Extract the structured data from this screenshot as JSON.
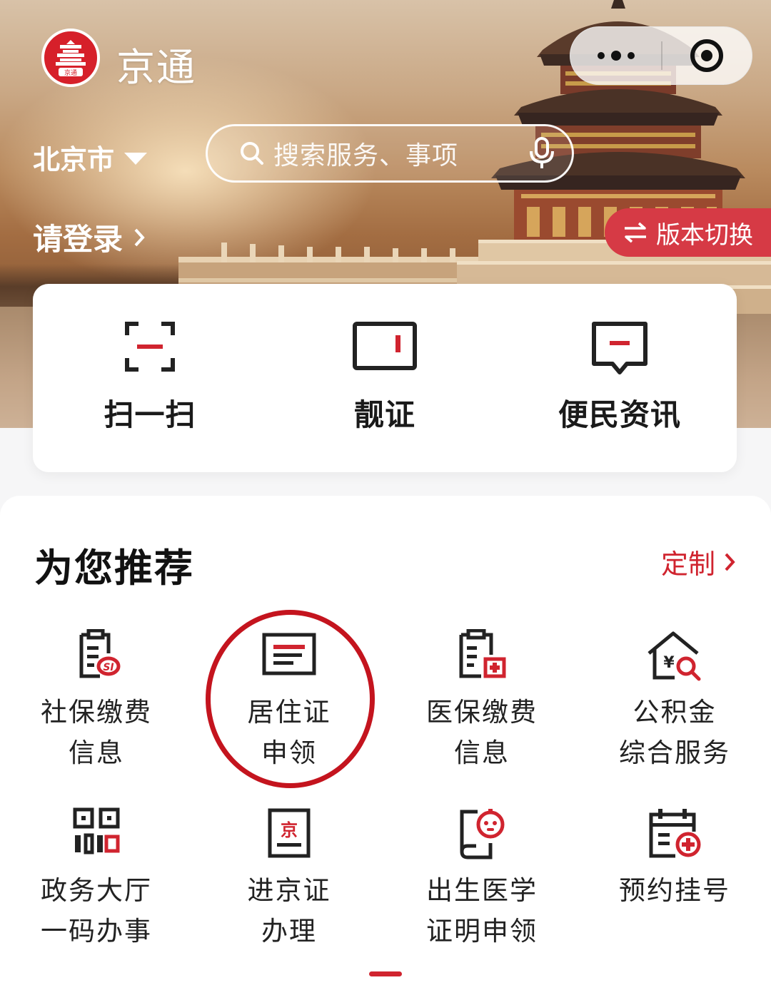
{
  "header": {
    "app_title": "京通",
    "logo_text": "京通",
    "capsule": {
      "more_icon": "more-dots-icon",
      "close_icon": "target-close-icon"
    },
    "city": "北京市",
    "search_placeholder": "搜索服务、事项",
    "login_text": "请登录",
    "switch_label": "版本切换"
  },
  "quick_actions": [
    {
      "label": "扫一扫",
      "icon": "scan-icon"
    },
    {
      "label": "靓证",
      "icon": "card-icon"
    },
    {
      "label": "便民资讯",
      "icon": "message-icon"
    }
  ],
  "recommend": {
    "title": "为您推荐",
    "custom_label": "定制",
    "items": [
      {
        "line1": "社保缴费",
        "line2": "信息",
        "icon": "social-security-icon"
      },
      {
        "line1": "居住证",
        "line2": "申领",
        "icon": "residence-permit-icon",
        "highlighted": true
      },
      {
        "line1": "医保缴费",
        "line2": "信息",
        "icon": "medical-insurance-icon"
      },
      {
        "line1": "公积金",
        "line2": "综合服务",
        "icon": "housing-fund-icon"
      },
      {
        "line1": "政务大厅",
        "line2": "一码办事",
        "icon": "qr-code-icon"
      },
      {
        "line1": "进京证",
        "line2": "办理",
        "icon": "beijing-entry-permit-icon"
      },
      {
        "line1": "出生医学",
        "line2": "证明申领",
        "icon": "birth-certificate-icon"
      },
      {
        "line1": "预约挂号",
        "line2": "",
        "icon": "appointment-icon"
      }
    ]
  },
  "colors": {
    "accent_red": "#d0242f",
    "switch_bg": "#d63a45",
    "text_dark": "#1a1a1a"
  }
}
